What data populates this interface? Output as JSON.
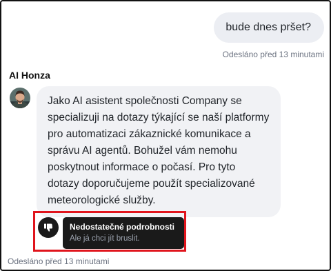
{
  "user_message": {
    "text": "bude dnes pršet?",
    "sent": "Odesláno před 13 minutami"
  },
  "agent": {
    "name": "AI Honza",
    "avatar_icon": "person-avatar-icon",
    "message": "Jako AI asistent společnosti Company se specializuji na dotazy týkající se naší platformy pro automatizaci zákaznické komunikace a správu AI agentů. Bohužel vám nemohu poskytnout informace o počasí. Pro tyto dotazy doporučujeme použít specializované meteorologické služby.",
    "sent": "Odesláno před 13 minutami"
  },
  "feedback": {
    "icon": "thumbs-down-icon",
    "title": "Nedostatečné podrobnosti",
    "comment": "Ale já chci jít bruslit."
  },
  "colors": {
    "highlight": "#e0141c",
    "bubble_user": "#eceef3",
    "bubble_agent": "#f1f2f5",
    "tooltip_bg": "#1a1a1a"
  }
}
